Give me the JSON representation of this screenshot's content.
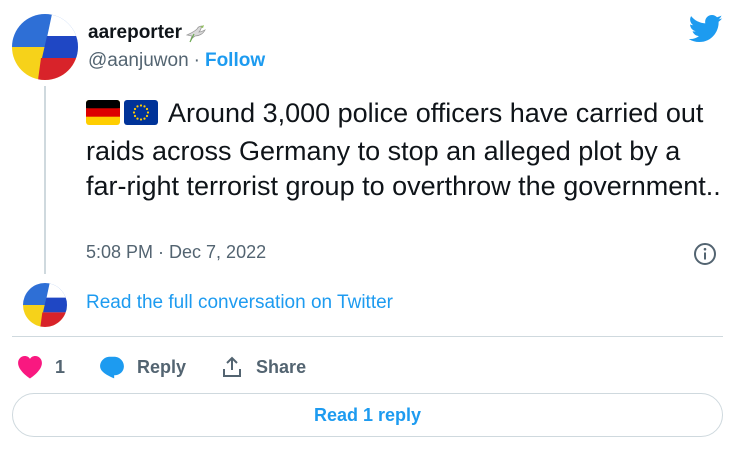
{
  "author": {
    "display_name": "aareporter",
    "handle": "@aanjuwon",
    "separator": "·",
    "follow_label": "Follow"
  },
  "tweet": {
    "text": "Around 3,000 police officers have carried out raids across Germany to stop an alleged plot by a far-right terrorist group to overthrow the government..",
    "timestamp": "5:08 PM · Dec 7, 2022"
  },
  "conversation_link": "Read the full conversation on Twitter",
  "actions": {
    "like_count": "1",
    "reply_label": "Reply",
    "share_label": "Share"
  },
  "read_reply_label": "Read 1 reply",
  "colors": {
    "accent": "#1d9bf0",
    "like": "#f91880",
    "muted": "#536471",
    "text": "#0f1419",
    "border": "#cfd9de"
  }
}
